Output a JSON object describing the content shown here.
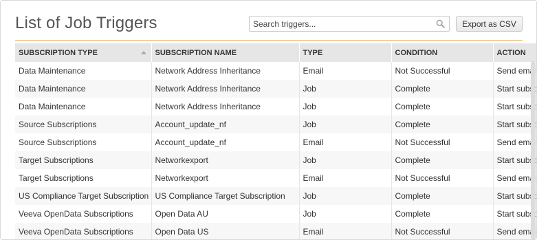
{
  "header": {
    "title": "List of Job Triggers",
    "search_placeholder": "Search triggers...",
    "search_value": "",
    "export_label": "Export as CSV"
  },
  "table": {
    "sorted_column": "SUBSCRIPTION TYPE",
    "sort_direction": "ascending",
    "columns": [
      "SUBSCRIPTION TYPE",
      "SUBSCRIPTION NAME",
      "TYPE",
      "CONDITION",
      "ACTION"
    ],
    "rows": [
      [
        "Data Maintenance",
        "Network Address Inheritance",
        "Email",
        "Not Successful",
        "Send email"
      ],
      [
        "Data Maintenance",
        "Network Address Inheritance",
        "Job",
        "Complete",
        "Start subscription"
      ],
      [
        "Data Maintenance",
        "Network Address Inheritance",
        "Job",
        "Complete",
        "Start subscription"
      ],
      [
        "Source Subscriptions",
        "Account_update_nf",
        "Job",
        "Complete",
        "Start subscription"
      ],
      [
        "Source Subscriptions",
        "Account_update_nf",
        "Email",
        "Not Successful",
        "Send email"
      ],
      [
        "Target Subscriptions",
        "Networkexport",
        "Job",
        "Complete",
        "Start subscription"
      ],
      [
        "Target Subscriptions",
        "Networkexport",
        "Email",
        "Not Successful",
        "Send email"
      ],
      [
        "US Compliance Target Subscription",
        "US Compliance Target Subscription",
        "Job",
        "Complete",
        "Start subscription"
      ],
      [
        "Veeva OpenData Subscriptions",
        "Open Data AU",
        "Job",
        "Complete",
        "Start subscription"
      ],
      [
        "Veeva OpenData Subscriptions",
        "Open Data US",
        "Email",
        "Not Successful",
        "Send email"
      ]
    ]
  },
  "colors": {
    "accent_divider": "#e8b76a",
    "header_bg": "#e6e6e6",
    "row_alt_bg": "#f7f7f7"
  }
}
